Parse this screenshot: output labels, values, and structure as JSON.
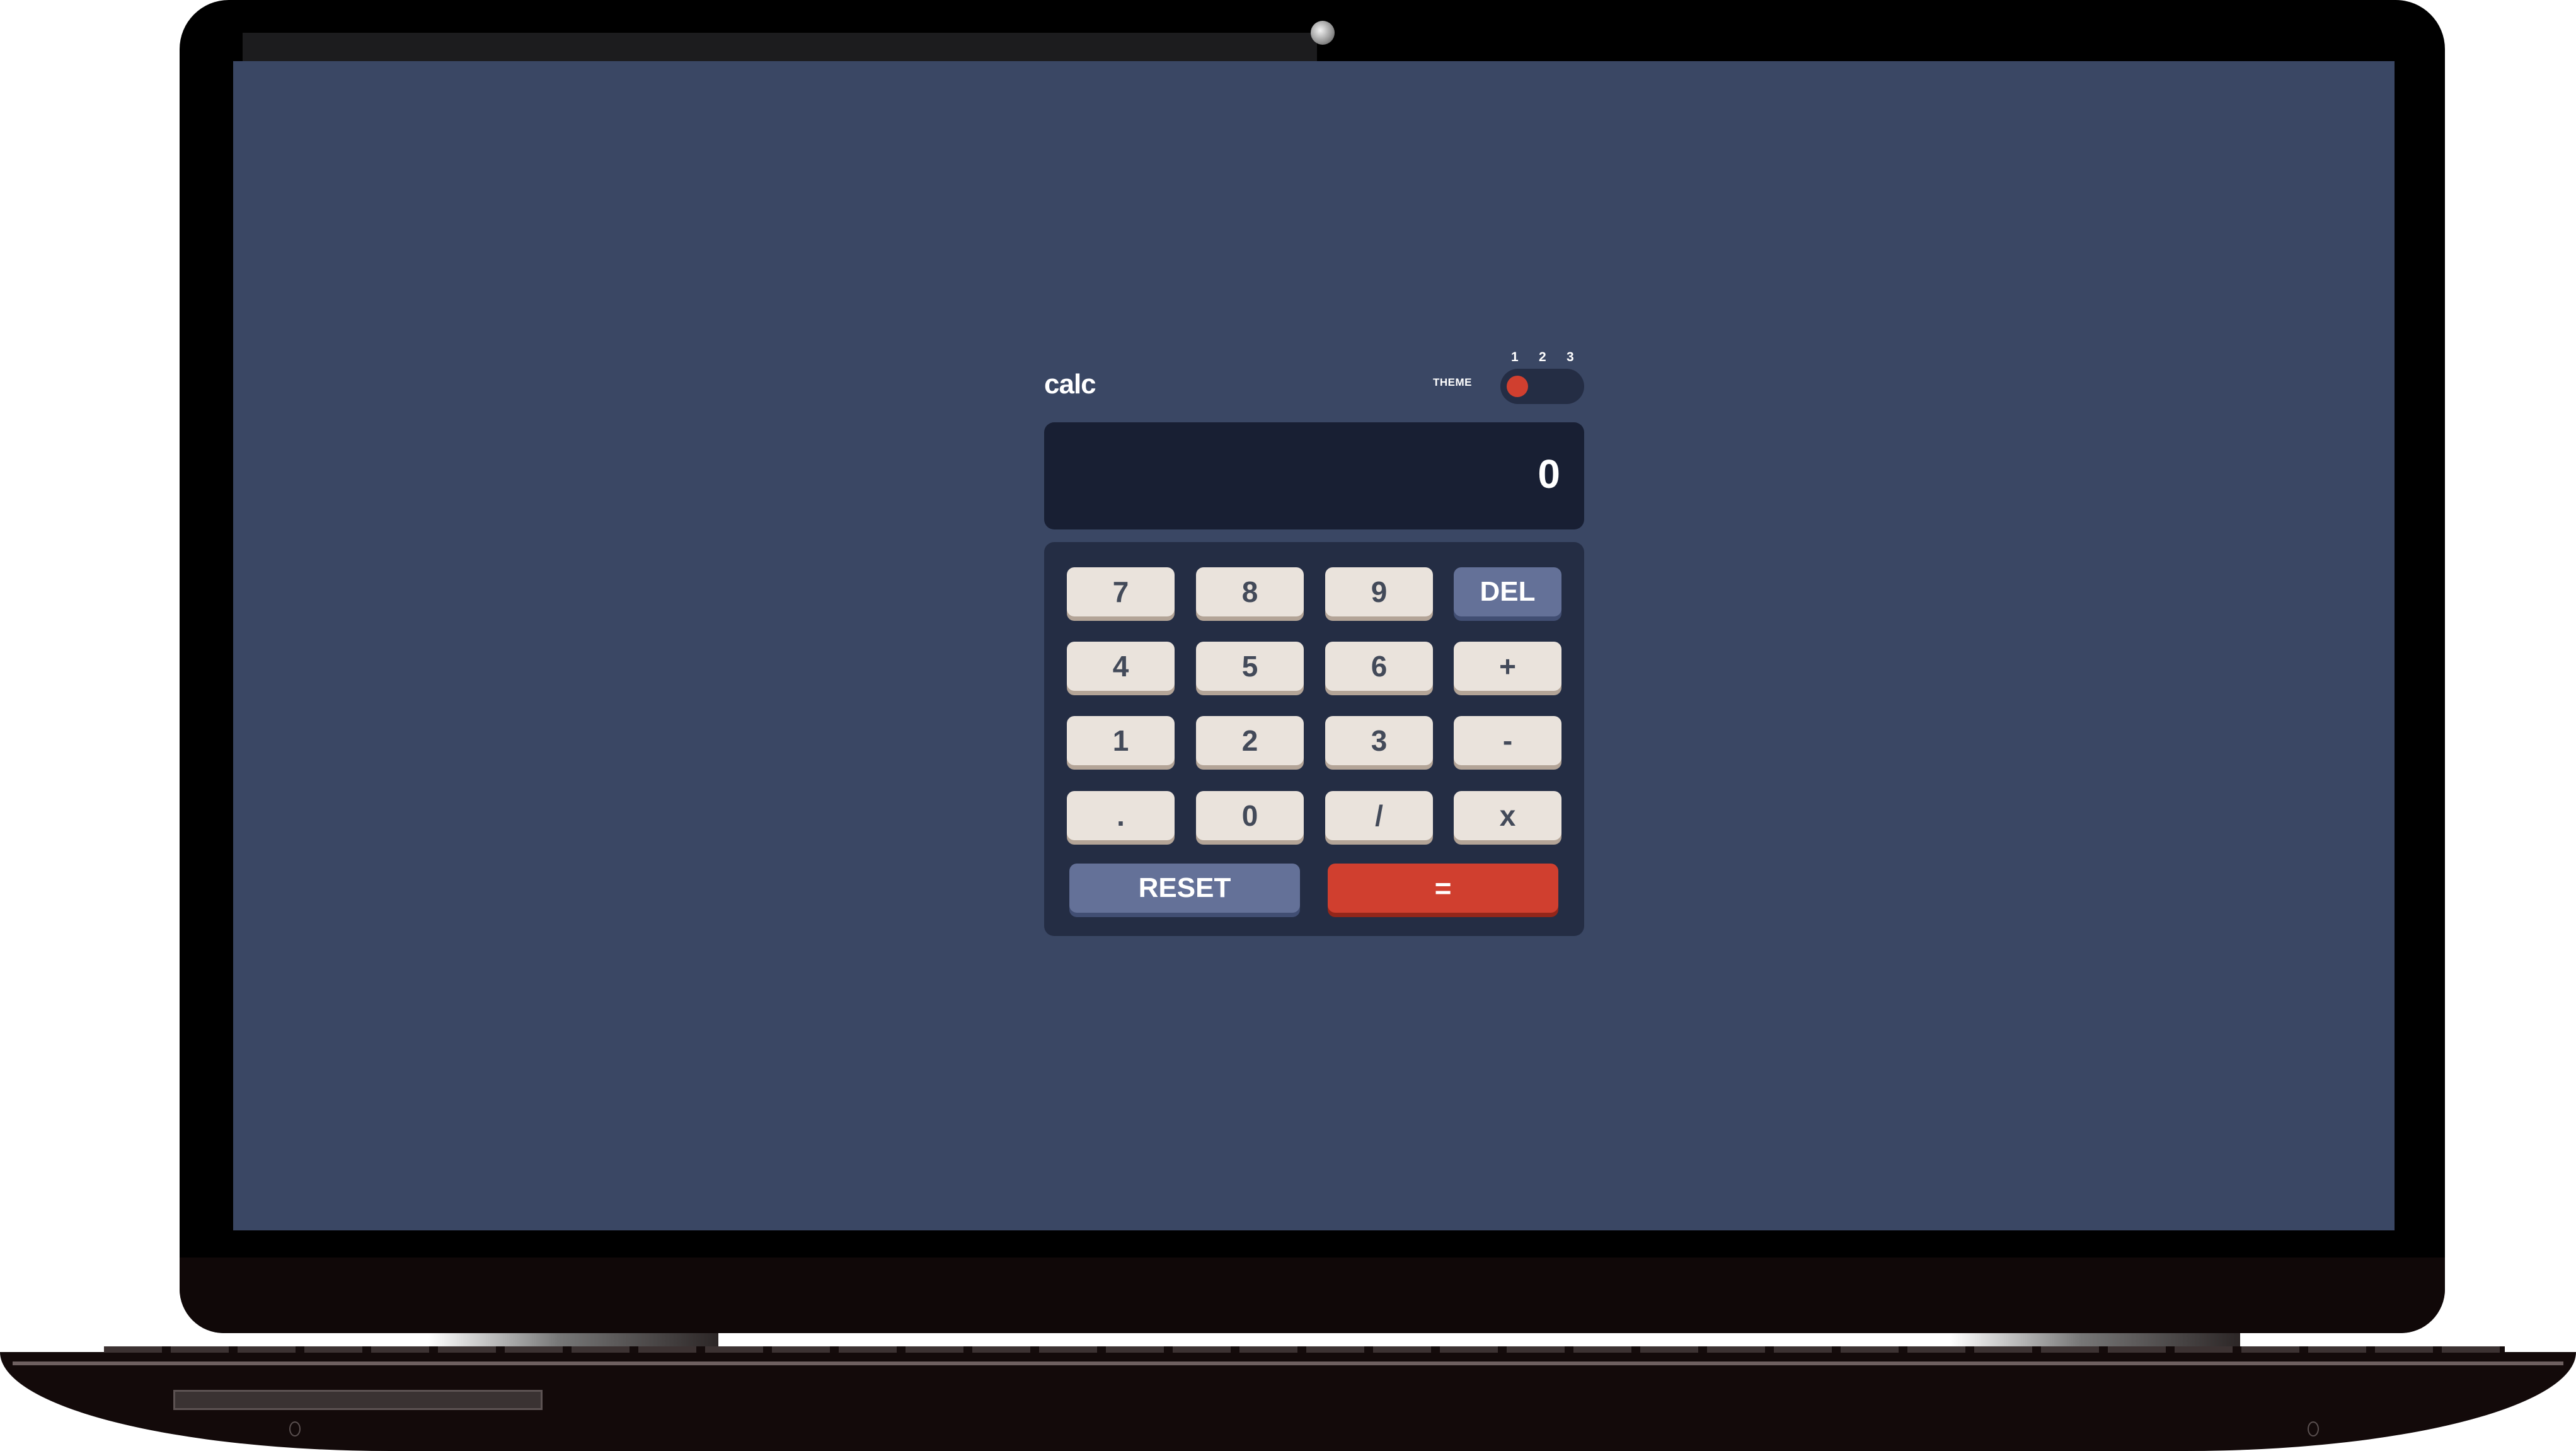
{
  "app": {
    "title": "calc",
    "theme": {
      "label": "THEME",
      "options": [
        "1",
        "2",
        "3"
      ],
      "selected": "1"
    },
    "display": {
      "value": "0"
    },
    "keypad": {
      "rows": [
        [
          "7",
          "8",
          "9",
          "DEL"
        ],
        [
          "4",
          "5",
          "6",
          "+"
        ],
        [
          "1",
          "2",
          "3",
          "-"
        ],
        [
          ".",
          "0",
          "/",
          "x"
        ]
      ],
      "reset_label": "RESET",
      "equals_label": "="
    }
  },
  "colors": {
    "screen_background": "#3a4764",
    "keypad_background": "#242d44",
    "display_background": "#181f33",
    "key_background": "#eae3dc",
    "key_text": "#434a59",
    "function_key": "#647198",
    "accent": "#d03f2f"
  }
}
